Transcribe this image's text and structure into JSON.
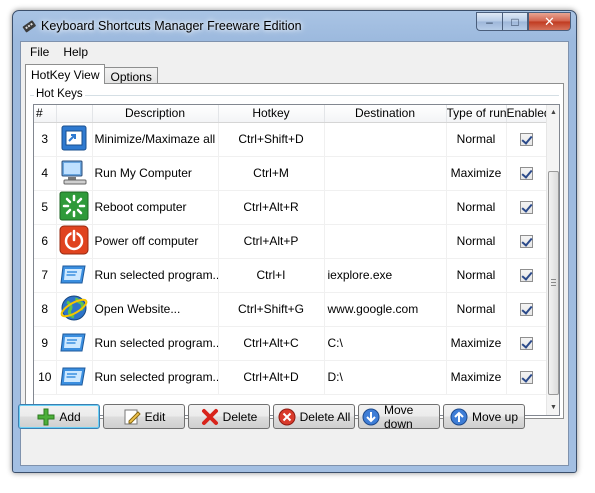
{
  "window": {
    "title": "Keyboard Shortcuts Manager Freeware Edition",
    "accent": "#1f5fa9"
  },
  "caption_buttons": {
    "minimize": "–",
    "maximize": "□",
    "close": "✕"
  },
  "menu": [
    "File",
    "Help"
  ],
  "tabs": [
    {
      "label": "HotKey View",
      "active": true
    },
    {
      "label": "Options",
      "active": false
    }
  ],
  "group": {
    "label": "Hot Keys"
  },
  "table": {
    "columns": [
      "#",
      "Description",
      "Hotkey",
      "Destination",
      "Type of run",
      "Enabled"
    ],
    "rows": [
      {
        "num": "3",
        "icon": "minimize-window-icon",
        "description": "Minimize/Maximaze all ...",
        "hotkey": "Ctrl+Shift+D",
        "destination": "",
        "type": "Normal",
        "enabled": true
      },
      {
        "num": "4",
        "icon": "my-computer-icon",
        "description": "Run My Computer",
        "hotkey": "Ctrl+M",
        "destination": "",
        "type": "Maximize",
        "enabled": true
      },
      {
        "num": "5",
        "icon": "reboot-icon",
        "description": "Reboot computer",
        "hotkey": "Ctrl+Alt+R",
        "destination": "",
        "type": "Normal",
        "enabled": true
      },
      {
        "num": "6",
        "icon": "power-off-icon",
        "description": "Power off computer",
        "hotkey": "Ctrl+Alt+P",
        "destination": "",
        "type": "Normal",
        "enabled": true
      },
      {
        "num": "7",
        "icon": "program-window-icon",
        "description": "Run selected program...",
        "hotkey": "Ctrl+I",
        "destination": "iexplore.exe",
        "type": "Normal",
        "enabled": true
      },
      {
        "num": "8",
        "icon": "globe-icon",
        "description": "Open Website...",
        "hotkey": "Ctrl+Shift+G",
        "destination": "www.google.com",
        "type": "Normal",
        "enabled": true
      },
      {
        "num": "9",
        "icon": "program-window-icon",
        "description": "Run selected program...",
        "hotkey": "Ctrl+Alt+C",
        "destination": "C:\\",
        "type": "Maximize",
        "enabled": true
      },
      {
        "num": "10",
        "icon": "program-window-icon",
        "description": "Run selected program...",
        "hotkey": "Ctrl+Alt+D",
        "destination": "D:\\",
        "type": "Maximize",
        "enabled": true
      }
    ]
  },
  "buttons": {
    "add": "Add",
    "edit": "Edit",
    "delete": "Delete",
    "delete_all": "Delete All",
    "move_down": "Move down",
    "move_up": "Move up"
  }
}
